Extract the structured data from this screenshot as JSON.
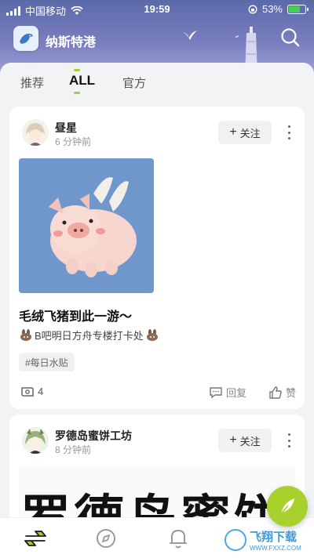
{
  "status_bar": {
    "carrier": "中国移动",
    "time": "19:59",
    "battery": "53%",
    "battery_level": 0.53
  },
  "header": {
    "app_name": "纳斯特港"
  },
  "tabs": [
    {
      "label": "推荐"
    },
    {
      "label": "ALL"
    },
    {
      "label": "官方"
    }
  ],
  "posts": [
    {
      "username": "昼星",
      "time": "6 分钟前",
      "follow_label": "关注",
      "title": "毛绒飞猪到此一游～",
      "subtitle": "B吧明日方舟专楼打卡处",
      "tag": "#每日水贴",
      "views": "4",
      "reply_label": "回复",
      "like_label": "赞"
    },
    {
      "username": "罗德岛蜜饼工坊",
      "time": "8 分钟前",
      "follow_label": "关注",
      "banner_text": "罗德岛蜜饼"
    }
  ],
  "watermark": {
    "cn": "飞翔下载",
    "en": "WWW.FXXZ.COM"
  },
  "colors": {
    "accent": "#a8d12e",
    "header_start": "#5a6aa8",
    "header_end": "#9ea4d8"
  }
}
